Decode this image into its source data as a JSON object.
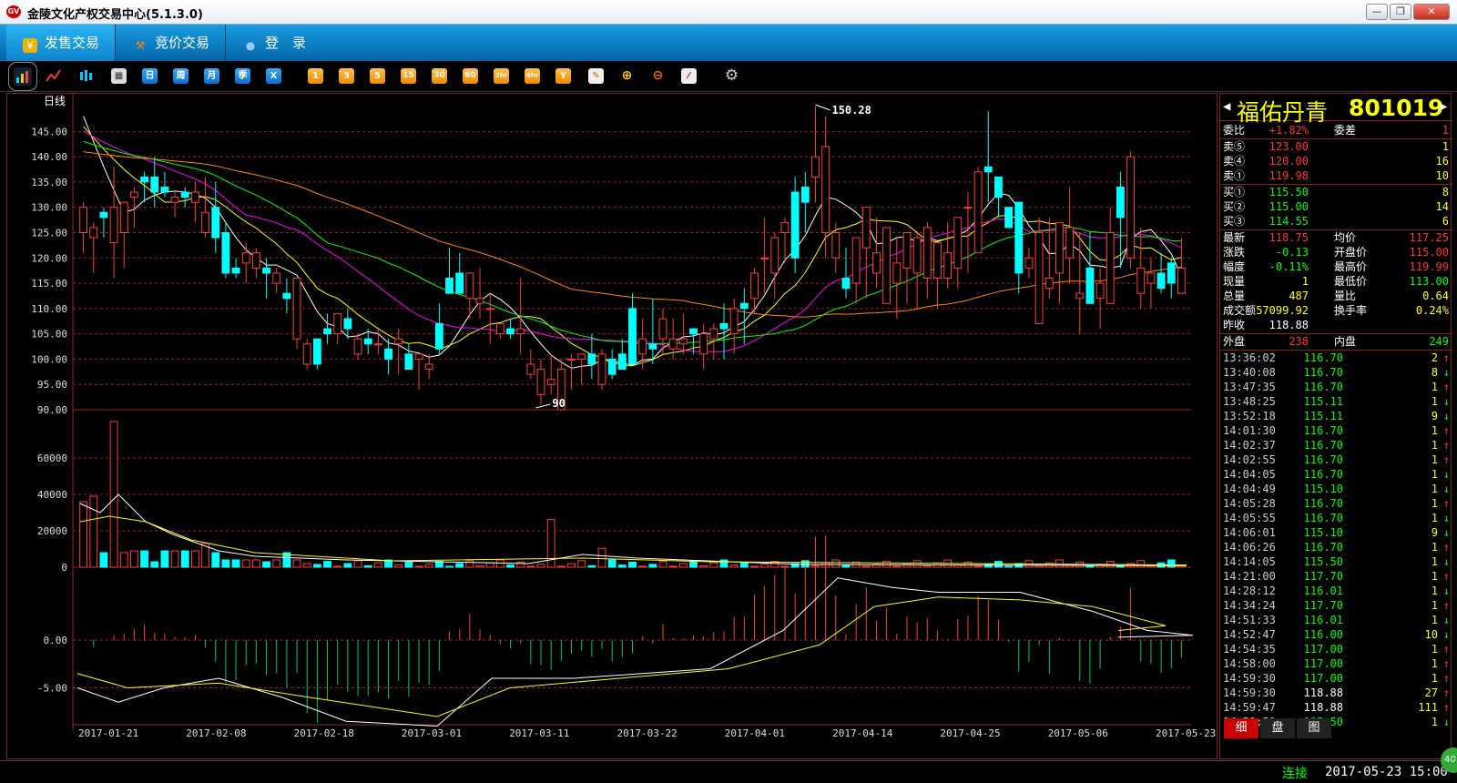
{
  "window": {
    "title": "金陵文化产权交易中心(5.1.3.0)",
    "logo": "GV"
  },
  "menu": [
    {
      "label": "发售交易",
      "icon": "yen-icon"
    },
    {
      "label": "竞价交易",
      "icon": "gavel-icon"
    },
    {
      "label": "登　录",
      "icon": "user-icon"
    }
  ],
  "toolbar": {
    "periods": [
      "日",
      "周",
      "月",
      "季",
      "X"
    ],
    "minutes": [
      "1",
      "3",
      "5",
      "15",
      "30",
      "60",
      "2hr",
      "4hr",
      "Y"
    ]
  },
  "chart": {
    "period_label": "日线",
    "max_label": "150.28",
    "min_label": "90",
    "price_ticks": [
      "145.00",
      "140.00",
      "135.00",
      "130.00",
      "125.00",
      "120.00",
      "115.00",
      "110.00",
      "105.00",
      "100.00",
      "95.00",
      "90.00"
    ],
    "vol_ticks": [
      "60000",
      "40000",
      "20000",
      "0"
    ],
    "macd_ticks": [
      "0.00",
      "-5.00"
    ],
    "dates": [
      "2017-01-21",
      "2017-02-08",
      "2017-02-18",
      "2017-03-01",
      "2017-03-11",
      "2017-03-22",
      "2017-04-01",
      "2017-04-14",
      "2017-04-25",
      "2017-05-06",
      "2017-05-23"
    ]
  },
  "chart_data": {
    "type": "candlestick",
    "title": "",
    "ylim": [
      90,
      150.28
    ],
    "candles": [
      [
        125,
        131,
        121,
        130
      ],
      [
        124,
        127,
        117,
        126
      ],
      [
        129,
        130,
        124,
        128
      ],
      [
        123,
        138,
        116,
        130
      ],
      [
        125,
        128,
        118,
        131
      ],
      [
        132,
        134,
        126,
        133
      ],
      [
        136,
        137,
        131,
        135
      ],
      [
        136,
        140,
        130,
        133
      ],
      [
        134,
        137,
        132,
        133
      ],
      [
        131,
        133,
        128,
        132
      ],
      [
        133,
        134,
        130,
        132
      ],
      [
        131,
        135,
        127,
        133
      ],
      [
        125,
        136,
        124,
        129
      ],
      [
        130,
        135,
        121,
        124
      ],
      [
        125,
        127,
        116,
        117
      ],
      [
        118,
        120,
        116,
        117
      ],
      [
        119,
        123,
        115,
        121
      ],
      [
        118,
        122,
        116,
        121
      ],
      [
        118,
        120,
        112,
        117
      ],
      [
        115,
        118,
        113,
        117
      ],
      [
        113,
        116,
        109,
        112
      ],
      [
        104,
        106,
        102,
        116
      ],
      [
        99,
        104,
        98,
        103
      ],
      [
        104,
        99,
        98,
        99
      ],
      [
        106,
        109,
        103,
        105
      ],
      [
        105,
        108,
        103,
        109
      ],
      [
        108,
        110,
        104,
        106
      ],
      [
        101,
        105,
        100,
        104
      ],
      [
        104,
        106,
        101,
        103
      ],
      [
        103,
        106,
        101,
        103
      ],
      [
        102,
        104,
        97,
        100
      ],
      [
        103,
        106,
        97,
        104
      ],
      [
        101,
        103,
        99,
        98
      ],
      [
        100,
        101,
        94,
        101
      ],
      [
        98,
        101,
        96,
        99
      ],
      [
        107,
        111,
        101,
        102
      ],
      [
        116,
        122,
        113,
        113
      ],
      [
        117,
        121,
        113,
        113
      ],
      [
        112,
        117,
        108,
        117
      ],
      [
        111,
        118,
        108,
        112
      ],
      [
        110,
        113,
        103,
        110
      ],
      [
        105,
        107,
        104,
        107
      ],
      [
        106,
        108,
        104,
        105
      ],
      [
        105,
        116,
        101,
        106
      ],
      [
        97,
        102,
        96,
        99
      ],
      [
        93,
        100,
        91,
        98
      ],
      [
        95,
        101,
        93,
        96
      ],
      [
        90,
        100,
        90,
        98
      ],
      [
        100,
        101,
        94,
        100
      ],
      [
        100,
        101,
        95,
        101
      ],
      [
        101,
        105,
        96,
        99
      ],
      [
        95,
        102,
        94,
        101
      ],
      [
        100,
        102,
        96,
        97
      ],
      [
        101,
        104,
        100,
        98
      ],
      [
        110,
        113,
        99,
        99
      ],
      [
        101,
        108,
        98,
        104
      ],
      [
        103,
        112,
        99,
        102
      ],
      [
        104,
        110,
        101,
        108
      ],
      [
        102,
        108,
        100,
        104
      ],
      [
        103,
        109,
        101,
        104
      ],
      [
        106,
        105,
        101,
        105
      ],
      [
        101,
        107,
        98,
        105
      ],
      [
        104,
        107,
        100,
        106
      ],
      [
        107,
        111,
        100,
        106
      ],
      [
        105,
        112,
        101,
        110
      ],
      [
        111,
        114,
        103,
        110
      ],
      [
        112,
        118,
        109,
        117
      ],
      [
        120,
        128,
        113,
        120
      ],
      [
        117,
        125,
        112,
        124
      ],
      [
        125,
        128,
        119,
        127
      ],
      [
        133,
        136,
        117,
        120
      ],
      [
        134,
        137,
        125,
        131
      ],
      [
        136,
        150,
        131,
        140
      ],
      [
        125,
        148,
        120,
        142
      ],
      [
        120,
        127,
        117,
        125
      ],
      [
        116,
        122,
        112,
        114
      ],
      [
        115,
        122,
        111,
        124
      ],
      [
        122,
        130,
        112,
        130
      ],
      [
        117,
        128,
        114,
        121
      ],
      [
        111,
        125,
        112,
        126
      ],
      [
        115,
        124,
        108,
        119
      ],
      [
        118,
        125,
        111,
        125
      ],
      [
        117,
        125,
        110,
        124
      ],
      [
        116,
        127,
        112,
        126
      ],
      [
        116,
        123,
        110,
        123
      ],
      [
        116,
        127,
        114,
        121
      ],
      [
        118,
        126,
        114,
        128
      ],
      [
        130,
        133,
        117,
        130
      ],
      [
        121,
        138,
        121,
        137
      ],
      [
        138,
        149,
        131,
        137
      ],
      [
        136,
        133,
        128,
        132
      ],
      [
        130,
        130,
        126,
        126
      ],
      [
        131,
        124,
        113,
        117
      ],
      [
        118,
        122,
        116,
        120
      ],
      [
        107,
        128,
        111,
        125
      ],
      [
        114,
        128,
        112,
        116
      ],
      [
        117,
        126,
        111,
        127
      ],
      [
        120,
        134,
        115,
        126
      ],
      [
        112,
        125,
        105,
        113
      ],
      [
        118,
        125,
        113,
        111
      ],
      [
        112,
        118,
        106,
        115
      ],
      [
        111,
        130,
        118,
        125
      ],
      [
        134,
        137,
        118,
        128
      ],
      [
        120,
        141,
        118,
        140
      ],
      [
        113,
        126,
        110,
        118
      ],
      [
        115,
        120,
        110,
        117
      ],
      [
        117,
        121,
        113,
        114
      ],
      [
        119,
        120,
        112,
        115
      ],
      [
        113,
        124,
        114,
        118
      ]
    ]
  },
  "quote": {
    "name": "福佑丹青",
    "code": "801019",
    "ratio_label": "委比",
    "ratio": "+1.82%",
    "diff_label": "委差",
    "diff": "1",
    "asks": [
      [
        "卖⑤",
        "123.00",
        "1"
      ],
      [
        "卖④",
        "120.00",
        "16"
      ],
      [
        "卖①",
        "119.98",
        "10"
      ]
    ],
    "bids": [
      [
        "买①",
        "115.50",
        "8"
      ],
      [
        "买②",
        "115.00",
        "14"
      ],
      [
        "买③",
        "114.55",
        "6"
      ]
    ],
    "stats": [
      [
        "最新",
        "118.75",
        "均价",
        "117.25"
      ],
      [
        "涨跌",
        "-0.13",
        "开盘价",
        "115.00"
      ],
      [
        "幅度",
        "-0.11%",
        "最高价",
        "119.99"
      ],
      [
        "现量",
        "1",
        "最低价",
        "113.00"
      ],
      [
        "总量",
        "487",
        "量比",
        "0.64"
      ],
      [
        "成交额",
        "57099.92",
        "换手率",
        "0.24%"
      ],
      [
        "昨收",
        "118.88",
        "",
        ""
      ]
    ],
    "outer_label": "外盘",
    "outer": "238",
    "inner_label": "内盘",
    "inner": "249",
    "ticks": [
      [
        "13:36:02",
        "116.70",
        "2",
        "↑"
      ],
      [
        "13:40:08",
        "116.70",
        "8",
        "↓"
      ],
      [
        "13:47:35",
        "116.70",
        "1",
        "↑"
      ],
      [
        "13:48:25",
        "115.11",
        "1",
        "↓"
      ],
      [
        "13:52:18",
        "115.11",
        "9",
        "↓"
      ],
      [
        "14:01:30",
        "116.70",
        "1",
        "↑"
      ],
      [
        "14:02:37",
        "116.70",
        "1",
        "↑"
      ],
      [
        "14:02:55",
        "116.70",
        "1",
        "↑"
      ],
      [
        "14:04:05",
        "116.70",
        "1",
        "↓"
      ],
      [
        "14:04:49",
        "115.10",
        "1",
        "↓"
      ],
      [
        "14:05:28",
        "116.70",
        "1",
        "↑"
      ],
      [
        "14:05:55",
        "116.70",
        "1",
        "↓"
      ],
      [
        "14:06:01",
        "115.10",
        "9",
        "↓"
      ],
      [
        "14:06:26",
        "116.70",
        "1",
        "↑"
      ],
      [
        "14:14:05",
        "115.50",
        "1",
        "↓"
      ],
      [
        "14:21:00",
        "117.70",
        "1",
        "↑"
      ],
      [
        "14:28:12",
        "116.01",
        "1",
        "↓"
      ],
      [
        "14:34:24",
        "117.70",
        "1",
        "↑"
      ],
      [
        "14:51:33",
        "116.01",
        "1",
        "↓"
      ],
      [
        "14:52:47",
        "116.00",
        "10",
        "↓"
      ],
      [
        "14:54:35",
        "117.00",
        "1",
        "↑"
      ],
      [
        "14:58:00",
        "117.00",
        "1",
        "↑"
      ],
      [
        "14:59:30",
        "117.00",
        "1",
        "↑"
      ],
      [
        "14:59:30",
        "118.88",
        "27",
        "↑"
      ],
      [
        "14:59:47",
        "118.88",
        "111",
        "↑"
      ],
      [
        "14:59:51",
        "115.50",
        "1",
        "↓"
      ]
    ],
    "tabs": [
      "细",
      "盘",
      "图"
    ]
  },
  "status": {
    "conn": "连接",
    "datetime": "2017-05-23 15:00",
    "badge": "40"
  }
}
